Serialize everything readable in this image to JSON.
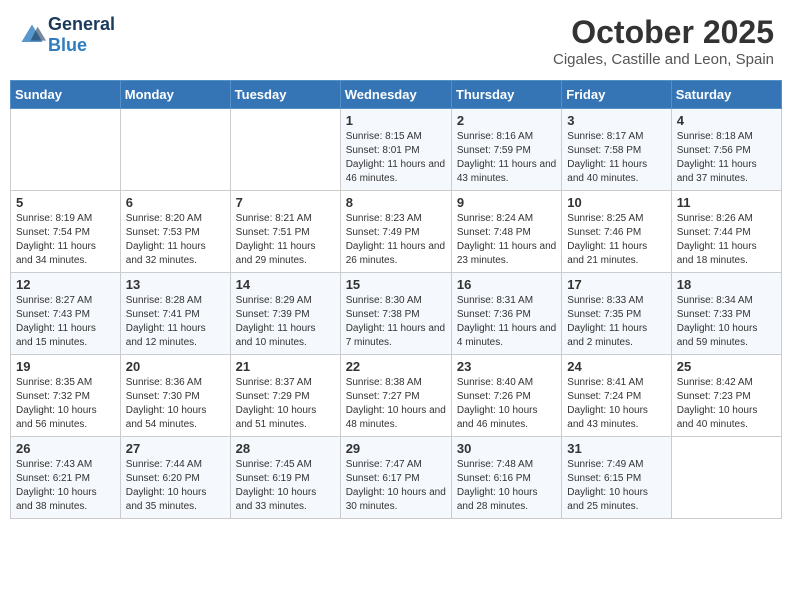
{
  "header": {
    "logo_general": "General",
    "logo_blue": "Blue",
    "title": "October 2025",
    "subtitle": "Cigales, Castille and Leon, Spain"
  },
  "calendar": {
    "days_of_week": [
      "Sunday",
      "Monday",
      "Tuesday",
      "Wednesday",
      "Thursday",
      "Friday",
      "Saturday"
    ],
    "weeks": [
      [
        {
          "day": "",
          "info": ""
        },
        {
          "day": "",
          "info": ""
        },
        {
          "day": "",
          "info": ""
        },
        {
          "day": "1",
          "info": "Sunrise: 8:15 AM\nSunset: 8:01 PM\nDaylight: 11 hours and 46 minutes."
        },
        {
          "day": "2",
          "info": "Sunrise: 8:16 AM\nSunset: 7:59 PM\nDaylight: 11 hours and 43 minutes."
        },
        {
          "day": "3",
          "info": "Sunrise: 8:17 AM\nSunset: 7:58 PM\nDaylight: 11 hours and 40 minutes."
        },
        {
          "day": "4",
          "info": "Sunrise: 8:18 AM\nSunset: 7:56 PM\nDaylight: 11 hours and 37 minutes."
        }
      ],
      [
        {
          "day": "5",
          "info": "Sunrise: 8:19 AM\nSunset: 7:54 PM\nDaylight: 11 hours and 34 minutes."
        },
        {
          "day": "6",
          "info": "Sunrise: 8:20 AM\nSunset: 7:53 PM\nDaylight: 11 hours and 32 minutes."
        },
        {
          "day": "7",
          "info": "Sunrise: 8:21 AM\nSunset: 7:51 PM\nDaylight: 11 hours and 29 minutes."
        },
        {
          "day": "8",
          "info": "Sunrise: 8:23 AM\nSunset: 7:49 PM\nDaylight: 11 hours and 26 minutes."
        },
        {
          "day": "9",
          "info": "Sunrise: 8:24 AM\nSunset: 7:48 PM\nDaylight: 11 hours and 23 minutes."
        },
        {
          "day": "10",
          "info": "Sunrise: 8:25 AM\nSunset: 7:46 PM\nDaylight: 11 hours and 21 minutes."
        },
        {
          "day": "11",
          "info": "Sunrise: 8:26 AM\nSunset: 7:44 PM\nDaylight: 11 hours and 18 minutes."
        }
      ],
      [
        {
          "day": "12",
          "info": "Sunrise: 8:27 AM\nSunset: 7:43 PM\nDaylight: 11 hours and 15 minutes."
        },
        {
          "day": "13",
          "info": "Sunrise: 8:28 AM\nSunset: 7:41 PM\nDaylight: 11 hours and 12 minutes."
        },
        {
          "day": "14",
          "info": "Sunrise: 8:29 AM\nSunset: 7:39 PM\nDaylight: 11 hours and 10 minutes."
        },
        {
          "day": "15",
          "info": "Sunrise: 8:30 AM\nSunset: 7:38 PM\nDaylight: 11 hours and 7 minutes."
        },
        {
          "day": "16",
          "info": "Sunrise: 8:31 AM\nSunset: 7:36 PM\nDaylight: 11 hours and 4 minutes."
        },
        {
          "day": "17",
          "info": "Sunrise: 8:33 AM\nSunset: 7:35 PM\nDaylight: 11 hours and 2 minutes."
        },
        {
          "day": "18",
          "info": "Sunrise: 8:34 AM\nSunset: 7:33 PM\nDaylight: 10 hours and 59 minutes."
        }
      ],
      [
        {
          "day": "19",
          "info": "Sunrise: 8:35 AM\nSunset: 7:32 PM\nDaylight: 10 hours and 56 minutes."
        },
        {
          "day": "20",
          "info": "Sunrise: 8:36 AM\nSunset: 7:30 PM\nDaylight: 10 hours and 54 minutes."
        },
        {
          "day": "21",
          "info": "Sunrise: 8:37 AM\nSunset: 7:29 PM\nDaylight: 10 hours and 51 minutes."
        },
        {
          "day": "22",
          "info": "Sunrise: 8:38 AM\nSunset: 7:27 PM\nDaylight: 10 hours and 48 minutes."
        },
        {
          "day": "23",
          "info": "Sunrise: 8:40 AM\nSunset: 7:26 PM\nDaylight: 10 hours and 46 minutes."
        },
        {
          "day": "24",
          "info": "Sunrise: 8:41 AM\nSunset: 7:24 PM\nDaylight: 10 hours and 43 minutes."
        },
        {
          "day": "25",
          "info": "Sunrise: 8:42 AM\nSunset: 7:23 PM\nDaylight: 10 hours and 40 minutes."
        }
      ],
      [
        {
          "day": "26",
          "info": "Sunrise: 7:43 AM\nSunset: 6:21 PM\nDaylight: 10 hours and 38 minutes."
        },
        {
          "day": "27",
          "info": "Sunrise: 7:44 AM\nSunset: 6:20 PM\nDaylight: 10 hours and 35 minutes."
        },
        {
          "day": "28",
          "info": "Sunrise: 7:45 AM\nSunset: 6:19 PM\nDaylight: 10 hours and 33 minutes."
        },
        {
          "day": "29",
          "info": "Sunrise: 7:47 AM\nSunset: 6:17 PM\nDaylight: 10 hours and 30 minutes."
        },
        {
          "day": "30",
          "info": "Sunrise: 7:48 AM\nSunset: 6:16 PM\nDaylight: 10 hours and 28 minutes."
        },
        {
          "day": "31",
          "info": "Sunrise: 7:49 AM\nSunset: 6:15 PM\nDaylight: 10 hours and 25 minutes."
        },
        {
          "day": "",
          "info": ""
        }
      ]
    ]
  }
}
